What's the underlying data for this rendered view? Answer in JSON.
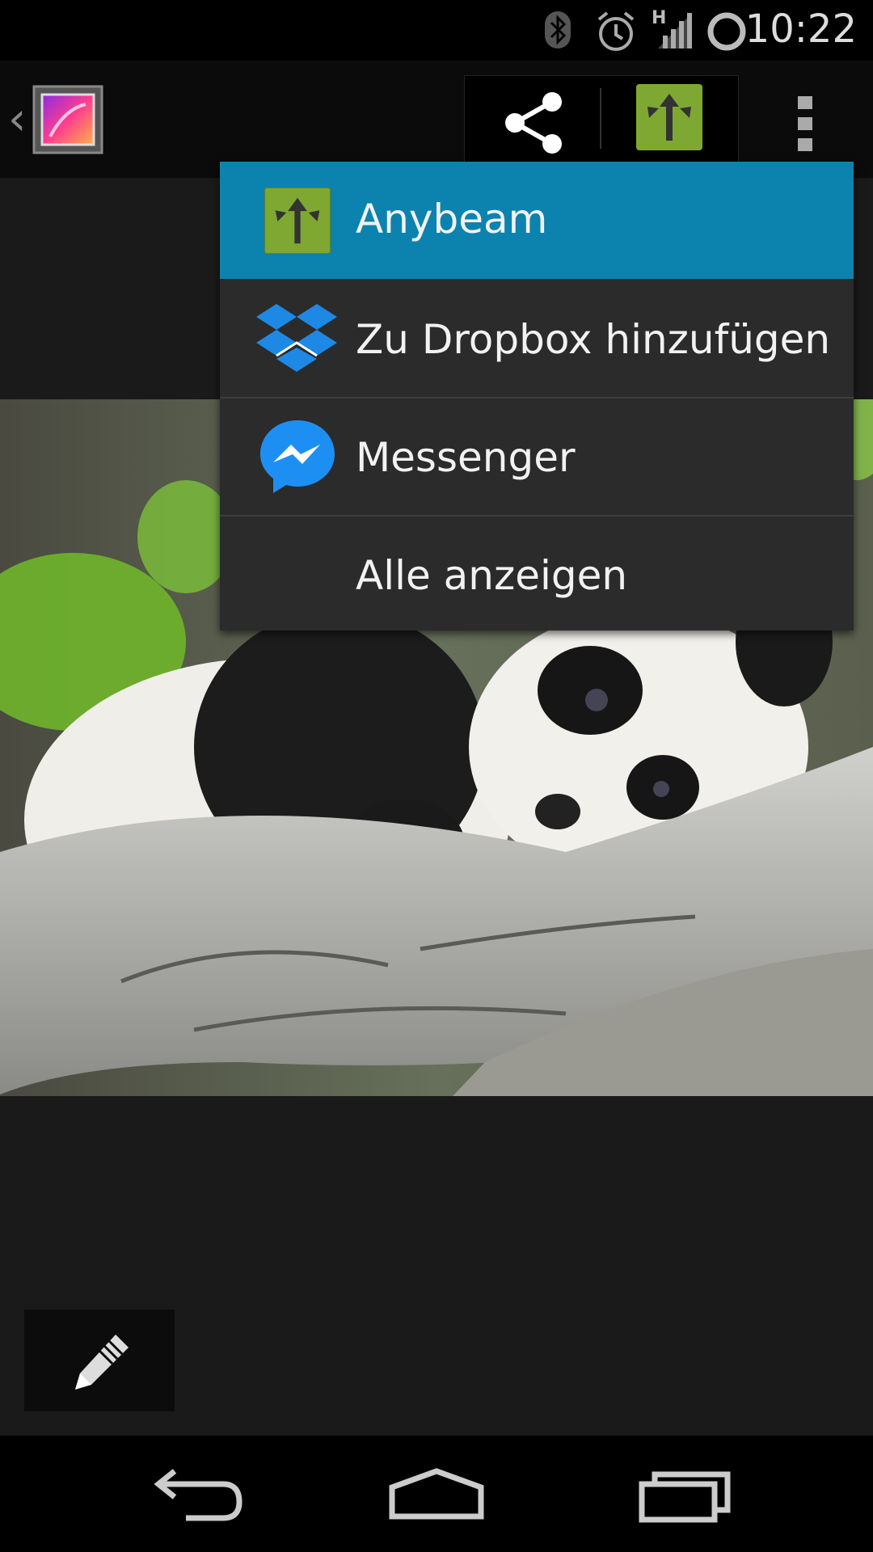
{
  "status_bar": {
    "time": "10:22",
    "network_type": "H",
    "icons": [
      "bluetooth-icon",
      "alarm-icon",
      "signal-icon",
      "sync-icon"
    ]
  },
  "action_bar": {
    "app_icon": "gallery-icon",
    "share_icon": "share-icon",
    "quick_share_icon": "anybeam-icon",
    "overflow_icon": "overflow-menu-icon"
  },
  "share_menu": {
    "items": [
      {
        "label": "Anybeam",
        "icon": "anybeam-icon",
        "highlighted": true
      },
      {
        "label": "Zu Dropbox hinzufügen",
        "icon": "dropbox-icon",
        "highlighted": false
      },
      {
        "label": "Messenger",
        "icon": "messenger-icon",
        "highlighted": false
      },
      {
        "label": "Alle anzeigen",
        "icon": "",
        "highlighted": false
      }
    ]
  },
  "photo": {
    "subject": "panda"
  },
  "edit_button": {
    "icon": "pencil-icon"
  },
  "nav_bar": {
    "icons": [
      "back-icon",
      "home-icon",
      "recents-icon"
    ]
  },
  "colors": {
    "menu_highlight": "#0c83ae",
    "menu_bg": "#2b2b2b",
    "anybeam_green": "#7ea832"
  }
}
